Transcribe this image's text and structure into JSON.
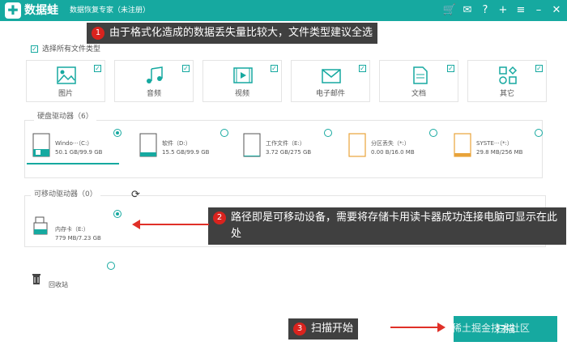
{
  "app": {
    "name": "数据蛙",
    "subtitle": "数据恢复专家（未注册）",
    "logo_glyph": "✚",
    "accent": "#16a9a0"
  },
  "title_icons": [
    "cart-icon",
    "mail-icon",
    "help-icon",
    "plus-icon",
    "menu-icon",
    "minimize-icon",
    "close-icon"
  ],
  "file_types": {
    "select_all_label": "选择所有文件类型",
    "select_all_checked": true,
    "items": [
      {
        "label": "图片",
        "icon": "image-icon",
        "checked": true
      },
      {
        "label": "音频",
        "icon": "music-icon",
        "checked": true
      },
      {
        "label": "视频",
        "icon": "video-icon",
        "checked": true
      },
      {
        "label": "电子邮件",
        "icon": "email-icon",
        "checked": true
      },
      {
        "label": "文档",
        "icon": "document-icon",
        "checked": true
      },
      {
        "label": "其它",
        "icon": "other-icon",
        "checked": true
      }
    ]
  },
  "hard_drives": {
    "title": "硬盘驱动器（6）",
    "drives": [
      {
        "name": "Windo···（C:）",
        "size": "50.1 GB/99.9 GB",
        "selected": true,
        "icon": "windows-drive-icon"
      },
      {
        "name": "软件（D:）",
        "size": "15.5 GB/99.9 GB",
        "selected": false,
        "icon": "drive-icon"
      },
      {
        "name": "工作文件（E:）",
        "size": "3.72 GB/275 GB",
        "selected": false,
        "icon": "drive-icon"
      },
      {
        "name": "分区丢失（*:）",
        "size": "0.00  B/16.0 MB",
        "selected": false,
        "icon": "lost-partition-icon"
      },
      {
        "name": "SYSTE···（*:）",
        "size": "29.8 MB/256 MB",
        "selected": false,
        "icon": "system-partition-icon"
      }
    ]
  },
  "removable": {
    "title": "可移动驱动器（0）",
    "drive": {
      "name": "内存卡（E:）",
      "size": "779 MB/7.23 GB",
      "selected": true,
      "icon": "usb-drive-icon"
    }
  },
  "recycle_bin": {
    "label": "回收站",
    "selected": false
  },
  "scan_button": {
    "label": "扫描"
  },
  "watermark": "@稀土掘金技术社区",
  "callouts": [
    {
      "number": "1",
      "text": "由于格式化造成的数据丢失量比较大，文件类型建议全选"
    },
    {
      "number": "2",
      "text": "路径即是可移动设备，需要将存储卡用读卡器成功连接电脑可显示在此处"
    },
    {
      "number": "3",
      "text": "扫描开始"
    }
  ]
}
